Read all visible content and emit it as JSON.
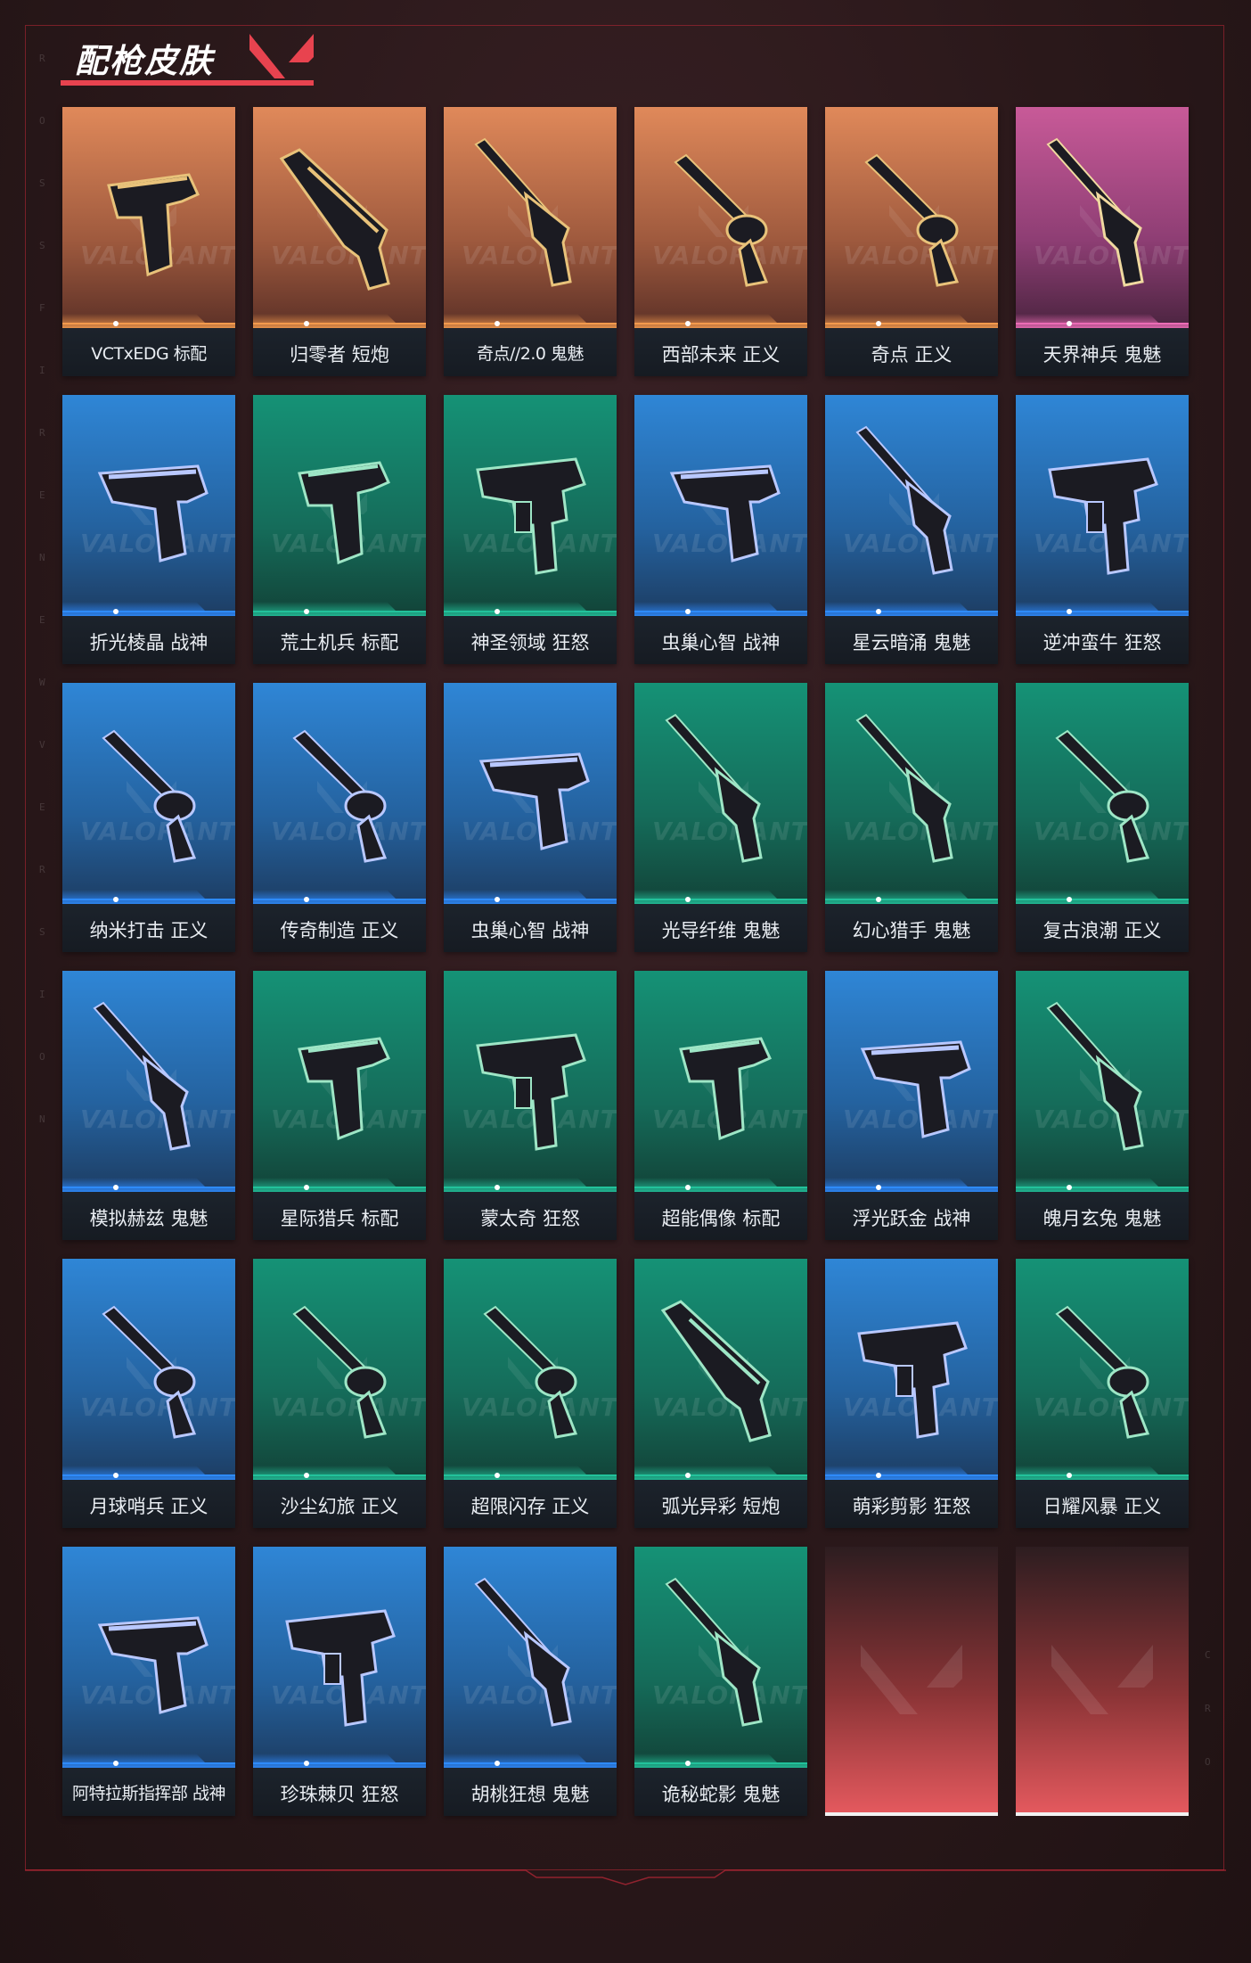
{
  "header": {
    "title": "配枪皮肤"
  },
  "side_letters_left": [
    "R",
    "O",
    "S",
    "S",
    "F",
    "I",
    "R",
    "E",
    "N",
    "E",
    "W",
    "V",
    "E",
    "R",
    "S",
    "I",
    "O",
    "N"
  ],
  "side_letters_right": [
    "C",
    "R",
    "O"
  ],
  "watermark_text": "VALORANT",
  "colors": {
    "orange": [
      "#e0895a",
      "#9f5a3e",
      "#5d3127"
    ],
    "pink": [
      "#c85a98",
      "#8e3e74",
      "#4b2440"
    ],
    "blue": [
      "#2f86d6",
      "#24629f",
      "#1d3d63"
    ],
    "green": [
      "#159276",
      "#156c5a",
      "#124338"
    ],
    "placeholder": [
      "#2d1d20",
      "#8b3436",
      "#e65a5f"
    ],
    "accent": "#e8434f"
  },
  "skins": [
    {
      "label": "VCTxEDG 标配",
      "rarity": "orange",
      "icon": "pistol-icon"
    },
    {
      "label": "归零者 短炮",
      "rarity": "orange",
      "icon": "shotgun-pistol-icon"
    },
    {
      "label": "奇点//2.0 鬼魅",
      "rarity": "orange",
      "icon": "silenced-pistol-icon"
    },
    {
      "label": "西部未来 正义",
      "rarity": "orange",
      "icon": "revolver-icon"
    },
    {
      "label": "奇点 正义",
      "rarity": "orange",
      "icon": "revolver-icon"
    },
    {
      "label": "天界神兵 鬼魅",
      "rarity": "pink",
      "icon": "silenced-pistol-icon"
    },
    {
      "label": "折光棱晶 战神",
      "rarity": "blue",
      "icon": "heavy-pistol-icon"
    },
    {
      "label": "荒土机兵 标配",
      "rarity": "green",
      "icon": "pistol-icon"
    },
    {
      "label": "神圣领域 狂怒",
      "rarity": "green",
      "icon": "machine-pistol-icon"
    },
    {
      "label": "虫巢心智 战神",
      "rarity": "blue",
      "icon": "heavy-pistol-icon"
    },
    {
      "label": "星云暗涌 鬼魅",
      "rarity": "blue",
      "icon": "silenced-pistol-icon"
    },
    {
      "label": "逆冲蛮牛 狂怒",
      "rarity": "blue",
      "icon": "machine-pistol-icon"
    },
    {
      "label": "纳米打击 正义",
      "rarity": "blue",
      "icon": "revolver-icon"
    },
    {
      "label": "传奇制造 正义",
      "rarity": "blue",
      "icon": "revolver-icon"
    },
    {
      "label": "虫巢心智 战神",
      "rarity": "blue",
      "icon": "heavy-pistol-icon"
    },
    {
      "label": "光导纤维 鬼魅",
      "rarity": "green",
      "icon": "silenced-pistol-icon"
    },
    {
      "label": "幻心猎手 鬼魅",
      "rarity": "green",
      "icon": "silenced-pistol-icon"
    },
    {
      "label": "复古浪潮 正义",
      "rarity": "green",
      "icon": "revolver-icon"
    },
    {
      "label": "模拟赫兹 鬼魅",
      "rarity": "blue",
      "icon": "silenced-pistol-icon"
    },
    {
      "label": "星际猎兵 标配",
      "rarity": "green",
      "icon": "pistol-icon"
    },
    {
      "label": "蒙太奇 狂怒",
      "rarity": "green",
      "icon": "machine-pistol-icon"
    },
    {
      "label": "超能偶像 标配",
      "rarity": "green",
      "icon": "pistol-icon"
    },
    {
      "label": "浮光跃金 战神",
      "rarity": "blue",
      "icon": "heavy-pistol-icon"
    },
    {
      "label": "魄月玄兔 鬼魅",
      "rarity": "green",
      "icon": "silenced-pistol-icon"
    },
    {
      "label": "月球哨兵 正义",
      "rarity": "blue",
      "icon": "revolver-icon"
    },
    {
      "label": "沙尘幻旅 正义",
      "rarity": "green",
      "icon": "revolver-icon"
    },
    {
      "label": "超限闪存 正义",
      "rarity": "green",
      "icon": "revolver-icon"
    },
    {
      "label": "弧光异彩 短炮",
      "rarity": "green",
      "icon": "shotgun-pistol-icon"
    },
    {
      "label": "萌彩剪影 狂怒",
      "rarity": "blue",
      "icon": "machine-pistol-icon"
    },
    {
      "label": "日耀风暴 正义",
      "rarity": "green",
      "icon": "revolver-icon"
    },
    {
      "label": "阿特拉斯指挥部 战神",
      "rarity": "blue",
      "icon": "heavy-pistol-icon"
    },
    {
      "label": "珍珠棘贝 狂怒",
      "rarity": "blue",
      "icon": "machine-pistol-icon"
    },
    {
      "label": "胡桃狂想 鬼魅",
      "rarity": "blue",
      "icon": "silenced-pistol-icon"
    },
    {
      "label": "诡秘蛇影 鬼魅",
      "rarity": "green",
      "icon": "silenced-pistol-icon"
    }
  ],
  "placeholders": [
    {
      "icon": "valorant-logo-icon"
    },
    {
      "icon": "valorant-logo-icon"
    }
  ]
}
